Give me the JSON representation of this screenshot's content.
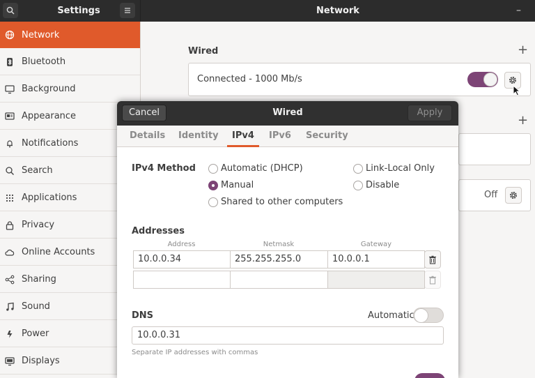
{
  "titlebar": {
    "left_title": "Settings",
    "main_title": "Network"
  },
  "sidebar": {
    "items": [
      {
        "label": "Network",
        "icon": "globe-icon"
      },
      {
        "label": "Bluetooth",
        "icon": "bluetooth-icon"
      },
      {
        "label": "Background",
        "icon": "monitor-icon"
      },
      {
        "label": "Appearance",
        "icon": "appearance-icon"
      },
      {
        "label": "Notifications",
        "icon": "bell-icon"
      },
      {
        "label": "Search",
        "icon": "search-icon"
      },
      {
        "label": "Applications",
        "icon": "grid-icon"
      },
      {
        "label": "Privacy",
        "icon": "lock-icon"
      },
      {
        "label": "Online Accounts",
        "icon": "cloud-icon"
      },
      {
        "label": "Sharing",
        "icon": "share-icon"
      },
      {
        "label": "Sound",
        "icon": "music-icon"
      },
      {
        "label": "Power",
        "icon": "power-icon"
      },
      {
        "label": "Displays",
        "icon": "display-icon"
      }
    ]
  },
  "network": {
    "wired_title": "Wired",
    "wired_status": "Connected - 1000 Mb/s",
    "proxy_status": "Off"
  },
  "dialog": {
    "cancel": "Cancel",
    "title": "Wired",
    "apply": "Apply",
    "tabs": [
      "Details",
      "Identity",
      "IPv4",
      "IPv6",
      "Security"
    ],
    "method_label": "IPv4 Method",
    "methods": {
      "auto": "Automatic (DHCP)",
      "manual": "Manual",
      "shared": "Shared to other computers",
      "link_local": "Link-Local Only",
      "disable": "Disable"
    },
    "addresses_label": "Addresses",
    "columns": [
      "Address",
      "Netmask",
      "Gateway"
    ],
    "rows": [
      [
        "10.0.0.34",
        "255.255.255.0",
        "10.0.0.1"
      ],
      [
        "",
        "",
        ""
      ]
    ],
    "dns_label": "DNS",
    "dns_auto_label": "Automatic",
    "dns_value": "10.0.0.31",
    "dns_hint": "Separate IP addresses with commas"
  }
}
